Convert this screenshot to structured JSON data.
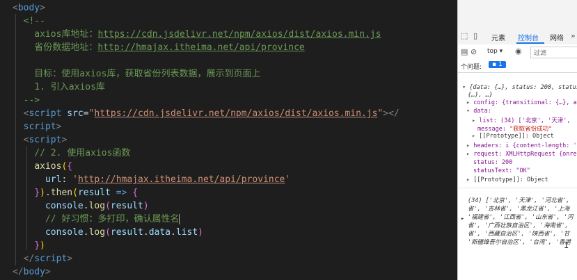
{
  "editor": {
    "lines": [
      {
        "segs": [
          {
            "t": "<",
            "c": "punc"
          },
          {
            "t": "body",
            "c": "tag"
          },
          {
            "t": ">",
            "c": "punc"
          }
        ]
      },
      {
        "segs": [
          {
            "t": "  <!--",
            "c": "cmt"
          }
        ]
      },
      {
        "segs": [
          {
            "t": "    axios库地址：",
            "c": "cmt"
          },
          {
            "t": "https://cdn.jsdelivr.net/npm/axios/dist/axios.min.js",
            "c": "cmt url"
          }
        ]
      },
      {
        "segs": [
          {
            "t": "    省份数据地址：",
            "c": "cmt"
          },
          {
            "t": "http://hmajax.itheima.net/api/province",
            "c": "cmt url"
          }
        ]
      },
      {
        "segs": []
      },
      {
        "segs": [
          {
            "t": "    目标：使用axios库，获取省份列表数据，展示到页面上",
            "c": "cmt"
          }
        ]
      },
      {
        "segs": [
          {
            "t": "    1. 引入axios库",
            "c": "cmt"
          }
        ]
      },
      {
        "segs": [
          {
            "t": "  -->",
            "c": "cmt"
          }
        ]
      },
      {
        "segs": [
          {
            "t": "  <",
            "c": "punc"
          },
          {
            "t": "script",
            "c": "tag"
          },
          {
            "t": " ",
            "c": ""
          },
          {
            "t": "src",
            "c": "attr"
          },
          {
            "t": "=",
            "c": ""
          },
          {
            "t": "\"",
            "c": "str"
          },
          {
            "t": "https://cdn.jsdelivr.net/npm/axios/dist/axios.min.js",
            "c": "str url"
          },
          {
            "t": "\"",
            "c": "str"
          },
          {
            "t": "></",
            "c": "punc"
          }
        ]
      },
      {
        "segs": [
          {
            "t": "  ",
            "c": ""
          },
          {
            "t": "script",
            "c": "tag"
          },
          {
            "t": ">",
            "c": "punc"
          }
        ]
      },
      {
        "segs": [
          {
            "t": "  <",
            "c": "punc"
          },
          {
            "t": "script",
            "c": "tag"
          },
          {
            "t": ">",
            "c": "punc"
          }
        ]
      },
      {
        "segs": [
          {
            "t": "    // 2. 使用axios函数",
            "c": "cmt"
          }
        ]
      },
      {
        "segs": [
          {
            "t": "    ",
            "c": ""
          },
          {
            "t": "axios",
            "c": "fn"
          },
          {
            "t": "(",
            "c": "yel"
          },
          {
            "t": "{",
            "c": "pur"
          }
        ]
      },
      {
        "segs": [
          {
            "t": "      ",
            "c": ""
          },
          {
            "t": "url",
            "c": "var"
          },
          {
            "t": ": ",
            "c": ""
          },
          {
            "t": "'",
            "c": "str"
          },
          {
            "t": "http://hmajax.itheima.net/api/province",
            "c": "str url"
          },
          {
            "t": "'",
            "c": "str"
          }
        ]
      },
      {
        "segs": [
          {
            "t": "    ",
            "c": ""
          },
          {
            "t": "}",
            "c": "pur"
          },
          {
            "t": ")",
            "c": "yel"
          },
          {
            "t": ".",
            "c": ""
          },
          {
            "t": "then",
            "c": "fn"
          },
          {
            "t": "(",
            "c": "yel"
          },
          {
            "t": "result",
            "c": "var"
          },
          {
            "t": " => ",
            "c": "tag"
          },
          {
            "t": "{",
            "c": "pur"
          }
        ]
      },
      {
        "segs": [
          {
            "t": "      ",
            "c": ""
          },
          {
            "t": "console",
            "c": "var"
          },
          {
            "t": ".",
            "c": ""
          },
          {
            "t": "log",
            "c": "fn"
          },
          {
            "t": "(",
            "c": "pur"
          },
          {
            "t": "result",
            "c": "var"
          },
          {
            "t": ")",
            "c": "pur"
          }
        ]
      },
      {
        "segs": [
          {
            "t": "      // 好习惯：多打印，确认属性名",
            "c": "cmt"
          },
          {
            "t": "",
            "c": "cursor"
          }
        ]
      },
      {
        "segs": [
          {
            "t": "      ",
            "c": ""
          },
          {
            "t": "console",
            "c": "var"
          },
          {
            "t": ".",
            "c": ""
          },
          {
            "t": "log",
            "c": "fn"
          },
          {
            "t": "(",
            "c": "pur"
          },
          {
            "t": "result",
            "c": "var"
          },
          {
            "t": ".",
            "c": ""
          },
          {
            "t": "data",
            "c": "var"
          },
          {
            "t": ".",
            "c": ""
          },
          {
            "t": "list",
            "c": "var"
          },
          {
            "t": ")",
            "c": "pur"
          }
        ]
      },
      {
        "segs": [
          {
            "t": "    ",
            "c": ""
          },
          {
            "t": "}",
            "c": "pur"
          },
          {
            "t": ")",
            "c": "yel"
          }
        ]
      },
      {
        "segs": [
          {
            "t": "  </",
            "c": "punc"
          },
          {
            "t": "script",
            "c": "tag"
          },
          {
            "t": ">",
            "c": "punc"
          }
        ]
      },
      {
        "segs": [
          {
            "t": "</",
            "c": "punc"
          },
          {
            "t": "body",
            "c": "tag"
          },
          {
            "t": ">",
            "c": "punc"
          }
        ]
      }
    ]
  },
  "devtools": {
    "tabs": {
      "elements": "元素",
      "console": "控制台",
      "network": "网络"
    },
    "toolbar": {
      "context": "top ▾",
      "filter_placeholder": "过滤"
    },
    "issues": {
      "label": "个问题:",
      "count": "1"
    },
    "log1": {
      "summary": "{data: {…}, status: 200, status",
      "summary2": "{…}, …}",
      "config": "config: {transitional: {…}, ad",
      "data": "data:",
      "list": "list: (34) ['北京', '天津',",
      "message_key": "message: ",
      "message_val": "\"获取省份成功\"",
      "proto1": "[[Prototype]]: Object",
      "headers": "headers: i {content-length: '",
      "request": "request: XMLHttpRequest {onrea",
      "status": "status: 200",
      "statusText": "statusText: \"OK\"",
      "proto2": "[[Prototype]]: Object"
    },
    "log2": {
      "l1": "(34) ['北京', '天津', '河北省',",
      "l2": "省', '吉林省', '黑龙江省', '上海",
      "l3": "'福建省', '江西省', '山东省', '河",
      "l4": "省', '广西壮族自治区', '海南省',",
      "l5": "省', '西藏自治区', '陕西省', '甘",
      "l6": "'新疆维吾尔自治区', '台湾', '香港"
    }
  }
}
